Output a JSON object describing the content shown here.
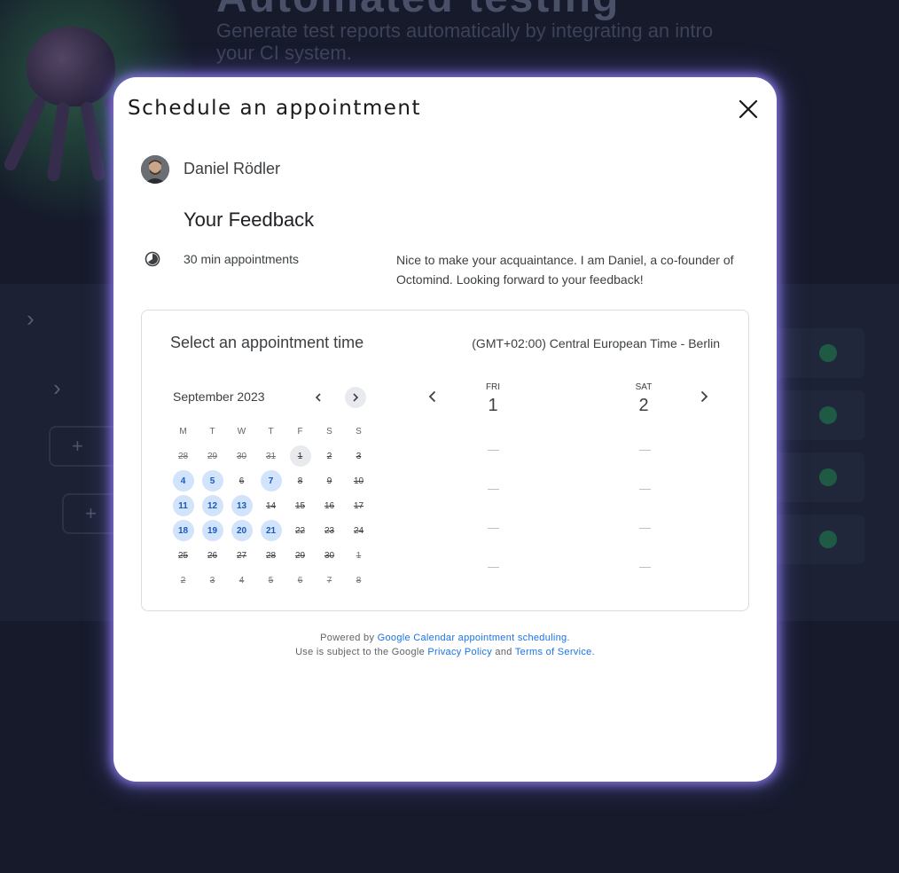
{
  "background": {
    "hero_title": "Automated testing",
    "hero_subtitle": "Generate test reports automatically by integrating an intro your CI system.",
    "add_label": "+"
  },
  "dialog": {
    "title": "Schedule an appointment",
    "close_icon": "close-icon",
    "host_name": "Daniel Rödler",
    "event_title": "Your Feedback",
    "duration": "30 min appointments",
    "description": "Nice to make your acquaintance. I am Daniel, a co-founder of Octomind. Looking forward to your feedback!"
  },
  "booking": {
    "heading": "Select an appointment time",
    "timezone": "(GMT+02:00) Central European Time - Berlin",
    "month": "September 2023",
    "weekdays": [
      "M",
      "T",
      "W",
      "T",
      "F",
      "S",
      "S"
    ],
    "weeks": [
      [
        {
          "d": "28",
          "s": "other"
        },
        {
          "d": "29",
          "s": "other"
        },
        {
          "d": "30",
          "s": "other"
        },
        {
          "d": "31",
          "s": "other"
        },
        {
          "d": "1",
          "s": "today"
        },
        {
          "d": "2",
          "s": "unavail"
        },
        {
          "d": "3",
          "s": "unavail"
        }
      ],
      [
        {
          "d": "4",
          "s": "avail"
        },
        {
          "d": "5",
          "s": "avail"
        },
        {
          "d": "6",
          "s": "unavail"
        },
        {
          "d": "7",
          "s": "avail"
        },
        {
          "d": "8",
          "s": "unavail"
        },
        {
          "d": "9",
          "s": "unavail"
        },
        {
          "d": "10",
          "s": "unavail"
        }
      ],
      [
        {
          "d": "11",
          "s": "avail"
        },
        {
          "d": "12",
          "s": "avail"
        },
        {
          "d": "13",
          "s": "avail"
        },
        {
          "d": "14",
          "s": "unavail"
        },
        {
          "d": "15",
          "s": "unavail"
        },
        {
          "d": "16",
          "s": "unavail"
        },
        {
          "d": "17",
          "s": "unavail"
        }
      ],
      [
        {
          "d": "18",
          "s": "avail"
        },
        {
          "d": "19",
          "s": "avail"
        },
        {
          "d": "20",
          "s": "avail"
        },
        {
          "d": "21",
          "s": "avail"
        },
        {
          "d": "22",
          "s": "unavail"
        },
        {
          "d": "23",
          "s": "unavail"
        },
        {
          "d": "24",
          "s": "unavail"
        }
      ],
      [
        {
          "d": "25",
          "s": "unavail"
        },
        {
          "d": "26",
          "s": "unavail"
        },
        {
          "d": "27",
          "s": "unavail"
        },
        {
          "d": "28",
          "s": "unavail"
        },
        {
          "d": "29",
          "s": "unavail"
        },
        {
          "d": "30",
          "s": "unavail"
        },
        {
          "d": "1",
          "s": "other"
        }
      ],
      [
        {
          "d": "2",
          "s": "other"
        },
        {
          "d": "3",
          "s": "other"
        },
        {
          "d": "4",
          "s": "other"
        },
        {
          "d": "5",
          "s": "other"
        },
        {
          "d": "6",
          "s": "other"
        },
        {
          "d": "7",
          "s": "other"
        },
        {
          "d": "8",
          "s": "other"
        }
      ]
    ],
    "days": [
      {
        "dow": "FRI",
        "num": "1"
      },
      {
        "dow": "SAT",
        "num": "2"
      }
    ],
    "slot_placeholder_count": 4
  },
  "footer": {
    "powered_prefix": "Powered by ",
    "powered_link": "Google Calendar appointment scheduling",
    "powered_suffix": ".",
    "terms_prefix": "Use is subject to the Google ",
    "privacy_link": "Privacy Policy",
    "terms_and": " and ",
    "terms_link": "Terms of Service",
    "terms_suffix": "."
  },
  "colors": {
    "available_bg": "#d2e3fc",
    "available_text": "#185abc",
    "link": "#1a73e8",
    "dialog_glow": "#9682ff"
  }
}
